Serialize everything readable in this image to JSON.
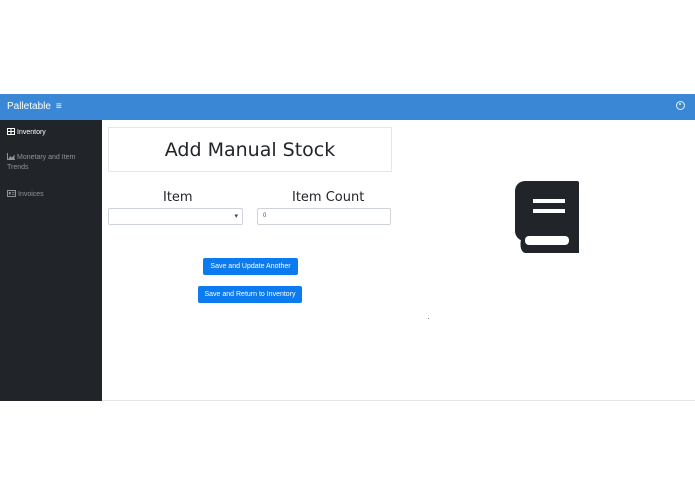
{
  "header": {
    "brand": "Palletable",
    "menu_icon": "hamburger-icon",
    "user_icon": "user-circle-icon",
    "color": "#3a87d6"
  },
  "sidebar": {
    "items": [
      {
        "label": "Inventory",
        "icon": "table-icon",
        "active": true
      },
      {
        "label": "Monetary and Item Trends",
        "icon": "area-chart-icon",
        "active": false
      },
      {
        "label": "Invoices",
        "icon": "invoice-icon",
        "active": false
      }
    ]
  },
  "main": {
    "title": "Add Manual Stock",
    "item_label": "Item",
    "item_select_value": "",
    "count_label": "Item Count",
    "count_value": "0",
    "save_update_label": "Save and Update Another",
    "save_return_label": "Save and Return to Inventory",
    "illustration_icon": "book-icon",
    "button_color": "#0d7bf0"
  }
}
